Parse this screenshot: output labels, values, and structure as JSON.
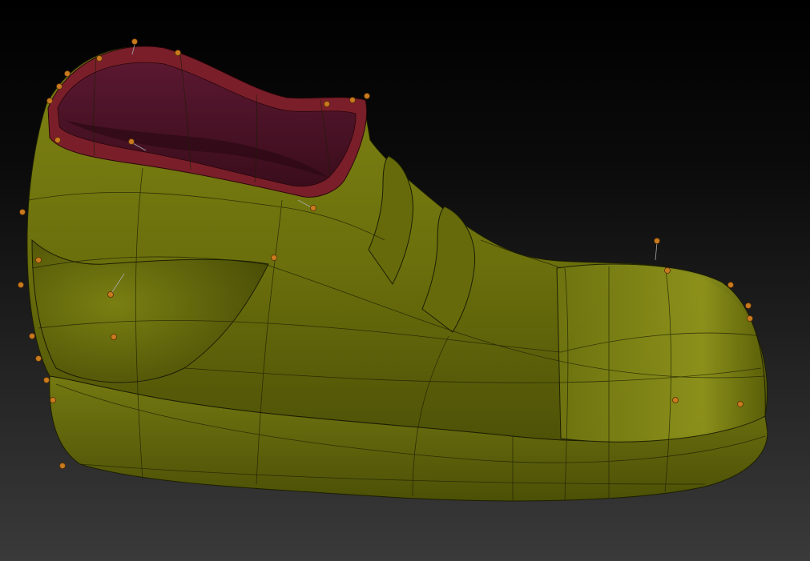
{
  "viewport": {
    "background_top": "#000000",
    "background_bottom": "#3a3a3a"
  },
  "model": {
    "body_color": "#6b6f0c",
    "body_highlight": "#8e931c",
    "body_shadow": "#3a3d05",
    "lining_color": "#4a1226",
    "lining_light": "#6a1d36",
    "collar_color": "#7a1f2a",
    "wire_color": "#1c1e02",
    "pin_color": "#c97a1e",
    "pin_outline": "#5a3005"
  }
}
